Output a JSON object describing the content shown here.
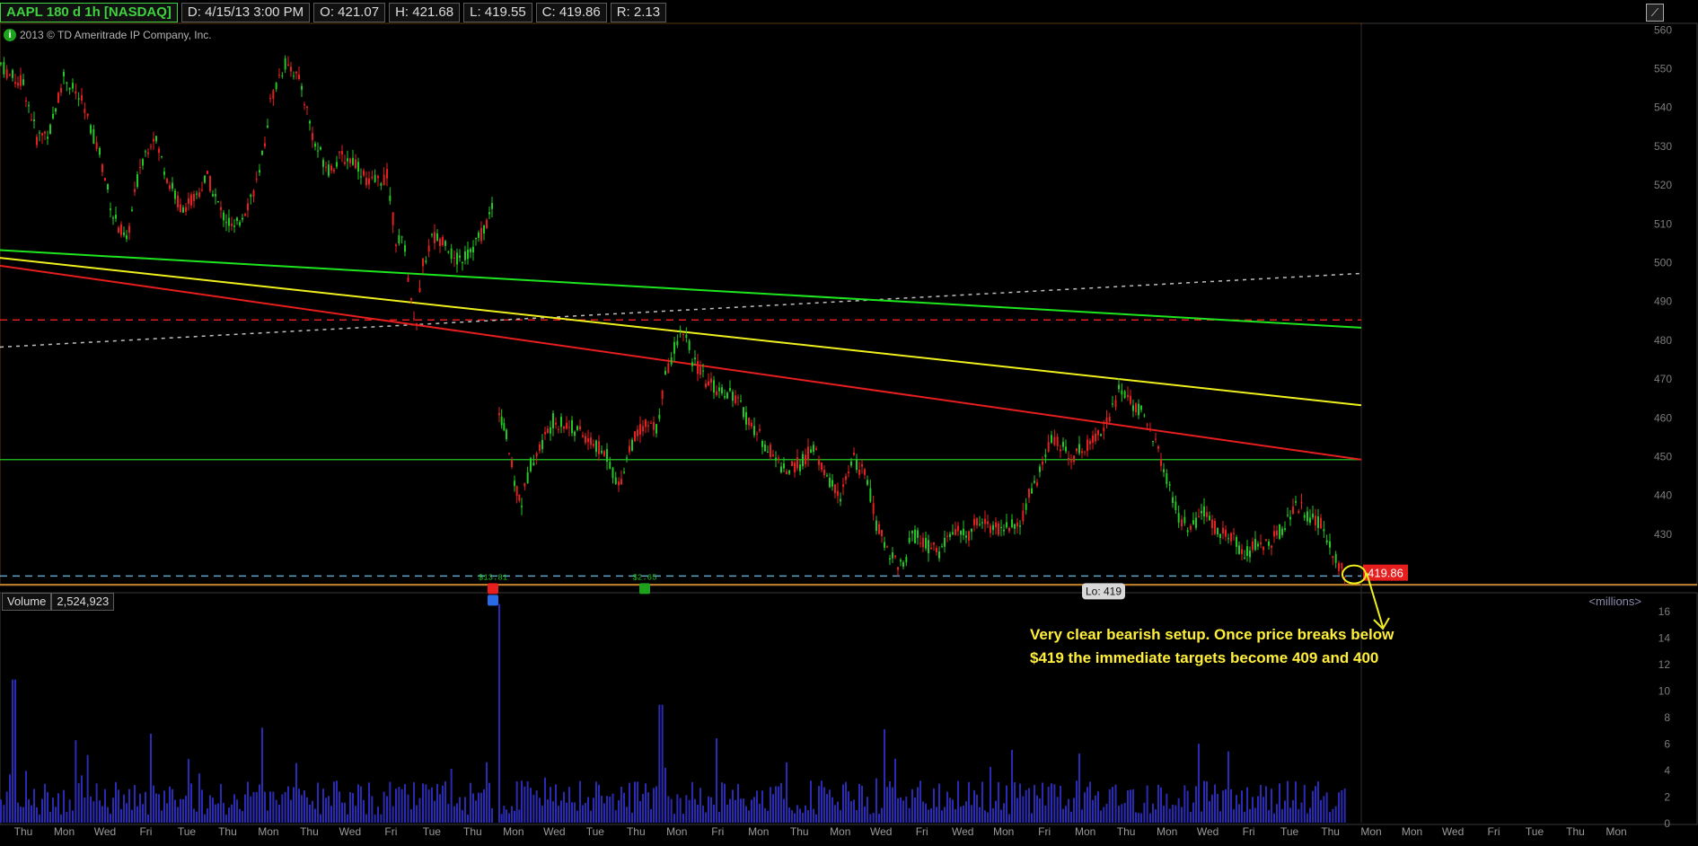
{
  "header": {
    "symbol": "AAPL 180 d 1h [NASDAQ]",
    "date": "D: 4/15/13 3:00 PM",
    "open": "O: 421.07",
    "high": "H: 421.68",
    "low": "L: 419.55",
    "close": "C: 419.86",
    "range": "R: 2.13"
  },
  "copyright": "2013 © TD Ameritrade IP Company, Inc.",
  "volume_panel": {
    "label": "Volume",
    "value": "2,524,923",
    "units": "<millions>"
  },
  "annotation": {
    "line1": "Very clear bearish setup. Once price breaks below",
    "line2": "$419 the immediate targets become 409 and 400"
  },
  "colors": {
    "up": "#22c822",
    "down": "#e61e1e",
    "green_trend": "#1ee61e",
    "yellow_trend": "#f0f01e",
    "red_trend": "#e61e1e",
    "volume": "#2a2ab4"
  },
  "chart_data": {
    "type": "candlestick",
    "title": "AAPL 180 d 1h [NASDAQ]",
    "price_axis": {
      "range": [
        417,
        561
      ],
      "ticks": [
        "560",
        "550",
        "540",
        "530",
        "520",
        "510",
        "500",
        "490",
        "480",
        "470",
        "460",
        "450",
        "440",
        "430"
      ]
    },
    "volume_axis": {
      "range": [
        0,
        16
      ],
      "ticks": [
        "16",
        "14",
        "12",
        "10",
        "8",
        "6",
        "4",
        "2",
        "0"
      ],
      "unit": "millions"
    },
    "x_ticks": [
      "Thu",
      "Mon",
      "Wed",
      "Fri",
      "Tue",
      "Thu",
      "Mon",
      "Thu",
      "Wed",
      "Fri",
      "Tue",
      "Thu",
      "Mon",
      "Wed",
      "Tue",
      "Thu",
      "Mon",
      "Fri",
      "Mon",
      "Thu",
      "Mon",
      "Wed",
      "Fri",
      "Wed",
      "Mon",
      "Fri",
      "Mon",
      "Thu",
      "Mon",
      "Wed",
      "Fri",
      "Tue",
      "Thu",
      "Mon",
      "Mon",
      "Wed",
      "Fri",
      "Tue",
      "Thu",
      "Mon"
    ],
    "price_path": [
      [
        0,
        551
      ],
      [
        10,
        548
      ],
      [
        25,
        546
      ],
      [
        40,
        532
      ],
      [
        55,
        534
      ],
      [
        70,
        548
      ],
      [
        90,
        541
      ],
      [
        110,
        528
      ],
      [
        125,
        512
      ],
      [
        140,
        505
      ],
      [
        155,
        525
      ],
      [
        170,
        533
      ],
      [
        185,
        522
      ],
      [
        200,
        514
      ],
      [
        215,
        516
      ],
      [
        230,
        522
      ],
      [
        245,
        513
      ],
      [
        260,
        508
      ],
      [
        275,
        515
      ],
      [
        288,
        522
      ],
      [
        300,
        541
      ],
      [
        310,
        548
      ],
      [
        320,
        552
      ],
      [
        335,
        545
      ],
      [
        350,
        530
      ],
      [
        365,
        524
      ],
      [
        380,
        527
      ],
      [
        395,
        526
      ],
      [
        410,
        520
      ],
      [
        430,
        522
      ],
      [
        440,
        506
      ],
      [
        450,
        504
      ],
      [
        457,
        489
      ],
      [
        463,
        485
      ],
      [
        470,
        499
      ],
      [
        480,
        506
      ],
      [
        495,
        506
      ],
      [
        505,
        500
      ],
      [
        520,
        502
      ],
      [
        535,
        507
      ],
      [
        550,
        515
      ],
      [
        555,
        462
      ],
      [
        563,
        455
      ],
      [
        572,
        443
      ],
      [
        580,
        438
      ],
      [
        590,
        448
      ],
      [
        600,
        452
      ],
      [
        615,
        459
      ],
      [
        630,
        458
      ],
      [
        645,
        456
      ],
      [
        660,
        453
      ],
      [
        675,
        450
      ],
      [
        688,
        442
      ],
      [
        700,
        452
      ],
      [
        715,
        458
      ],
      [
        730,
        457
      ],
      [
        740,
        470
      ],
      [
        750,
        478
      ],
      [
        760,
        483
      ],
      [
        770,
        475
      ],
      [
        785,
        469
      ],
      [
        800,
        467
      ],
      [
        815,
        466
      ],
      [
        830,
        460
      ],
      [
        845,
        455
      ],
      [
        860,
        450
      ],
      [
        875,
        446
      ],
      [
        890,
        448
      ],
      [
        905,
        452
      ],
      [
        920,
        444
      ],
      [
        935,
        440
      ],
      [
        950,
        449
      ],
      [
        965,
        444
      ],
      [
        975,
        432
      ],
      [
        990,
        425
      ],
      [
        1005,
        421
      ],
      [
        1015,
        430
      ],
      [
        1030,
        427
      ],
      [
        1045,
        425
      ],
      [
        1060,
        431
      ],
      [
        1075,
        429
      ],
      [
        1090,
        434
      ],
      [
        1105,
        431
      ],
      [
        1120,
        432
      ],
      [
        1135,
        432
      ],
      [
        1145,
        440
      ],
      [
        1160,
        447
      ],
      [
        1170,
        455
      ],
      [
        1180,
        452
      ],
      [
        1195,
        450
      ],
      [
        1210,
        453
      ],
      [
        1225,
        457
      ],
      [
        1238,
        462
      ],
      [
        1245,
        467
      ],
      [
        1255,
        465
      ],
      [
        1270,
        461
      ],
      [
        1280,
        457
      ],
      [
        1295,
        447
      ],
      [
        1305,
        438
      ],
      [
        1315,
        433
      ],
      [
        1325,
        431
      ],
      [
        1340,
        435
      ],
      [
        1355,
        431
      ],
      [
        1370,
        429
      ],
      [
        1385,
        425
      ],
      [
        1400,
        427
      ],
      [
        1415,
        428
      ],
      [
        1430,
        432
      ],
      [
        1442,
        438
      ],
      [
        1455,
        435
      ],
      [
        1470,
        432
      ],
      [
        1480,
        427
      ],
      [
        1490,
        422
      ],
      [
        1500,
        420
      ]
    ],
    "trend_lines": [
      {
        "name": "green",
        "color": "#1ee61e",
        "from": [
          0,
          503
        ],
        "to": [
          1516,
          483
        ]
      },
      {
        "name": "yellow",
        "color": "#f0f01e",
        "from": [
          0,
          501
        ],
        "to": [
          1516,
          463
        ]
      },
      {
        "name": "red",
        "color": "#e61e1e",
        "from": [
          0,
          499
        ],
        "to": [
          1516,
          449
        ]
      }
    ],
    "horizontal_lines": [
      {
        "name": "support-449",
        "value": 449,
        "color": "#1eaa1e",
        "style": "solid"
      },
      {
        "name": "resistance-485",
        "value": 485,
        "color": "#dc1e1e",
        "style": "dashed"
      },
      {
        "name": "low-419",
        "value": 419,
        "color": "#64a0c8",
        "style": "dashed"
      }
    ],
    "dotted_line": {
      "color": "#bebebe",
      "from": [
        0,
        478
      ],
      "to": [
        1516,
        497
      ]
    },
    "last_price": "419.86",
    "low_label": "Lo: 419",
    "markers": [
      {
        "label": "$13.81",
        "x": 549
      },
      {
        "label": "$2.65",
        "x": 718
      }
    ]
  }
}
